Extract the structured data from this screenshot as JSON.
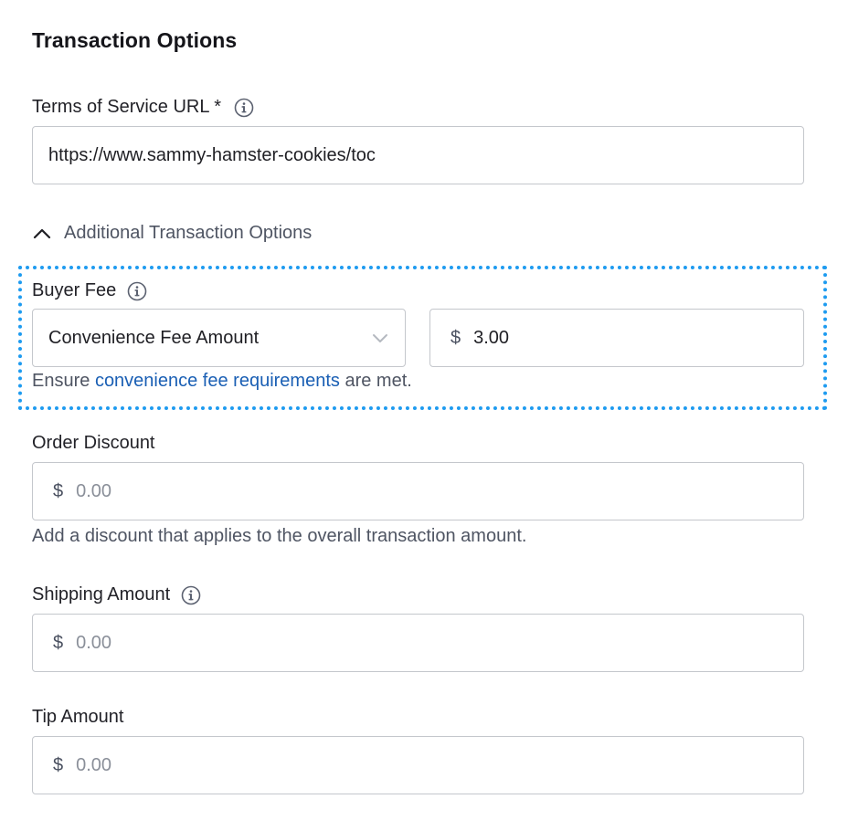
{
  "title": "Transaction Options",
  "terms": {
    "label": "Terms of Service URL *",
    "value": "https://www.sammy-hamster-cookies/toc"
  },
  "additional_toggle": "Additional Transaction Options",
  "buyer_fee": {
    "label": "Buyer Fee",
    "select_value": "Convenience Fee Amount",
    "currency": "$",
    "amount": "3.00",
    "help_prefix": "Ensure ",
    "help_link": "convenience fee requirements",
    "help_suffix": " are met."
  },
  "order_discount": {
    "label": "Order Discount",
    "currency": "$",
    "placeholder": "0.00",
    "help": "Add a discount that applies to the overall transaction amount."
  },
  "shipping_amount": {
    "label": "Shipping Amount",
    "currency": "$",
    "placeholder": "0.00"
  },
  "tip_amount": {
    "label": "Tip Amount",
    "currency": "$",
    "placeholder": "0.00"
  }
}
